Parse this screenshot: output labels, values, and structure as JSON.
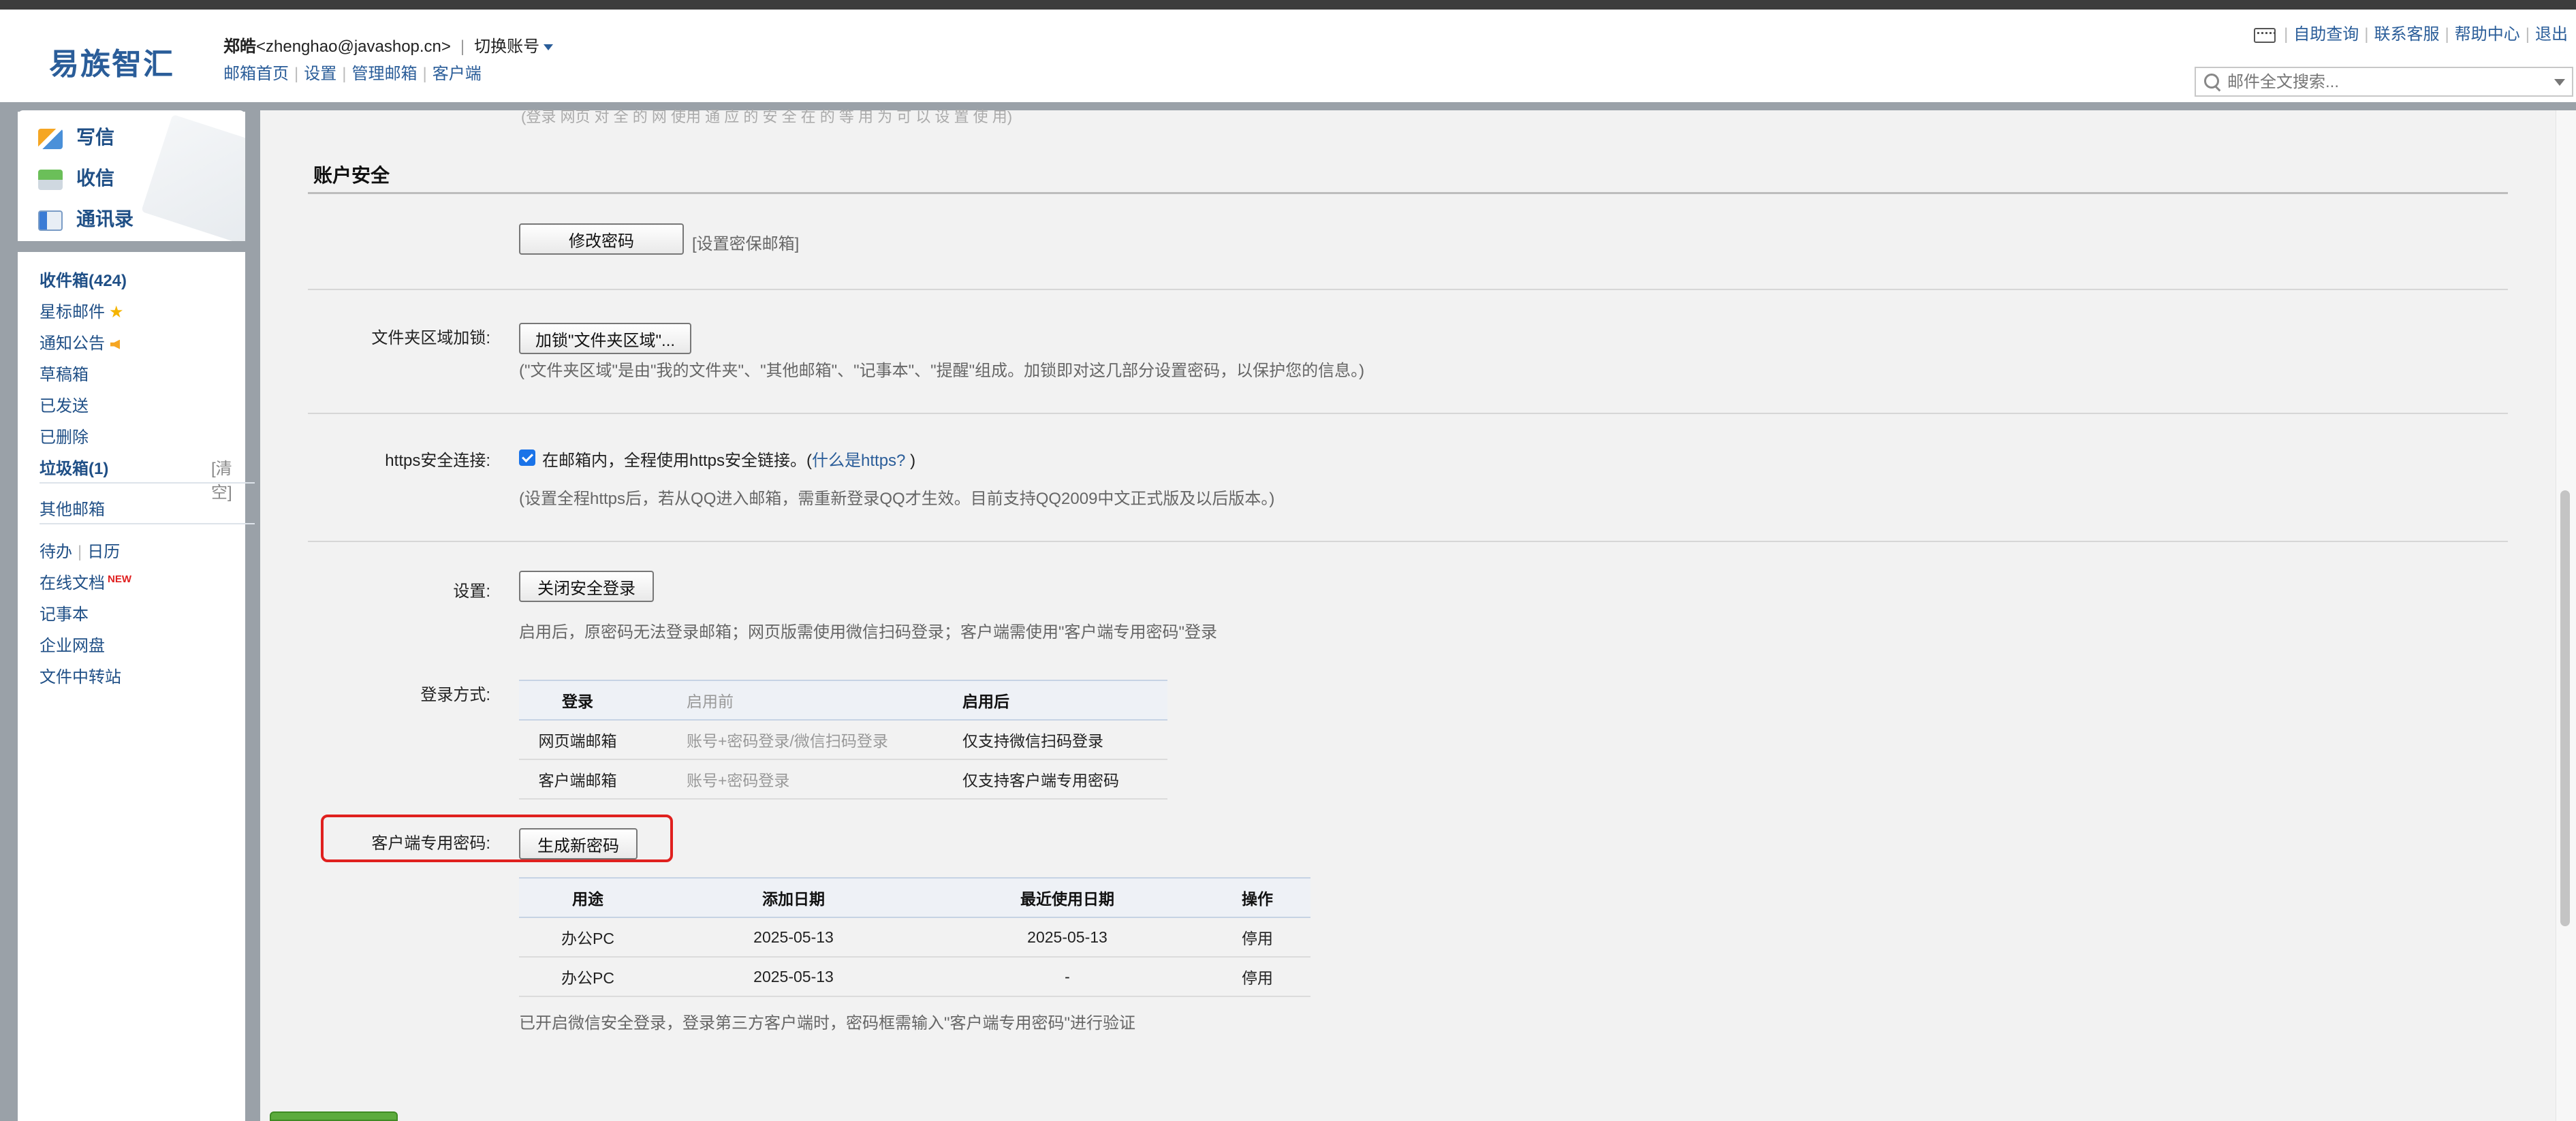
{
  "header": {
    "logo": "易族智汇",
    "user_name": "郑皓",
    "user_email": "<zhenghao@javashop.cn>",
    "switch_account": "切换账号",
    "links": [
      "邮箱首页",
      "设置",
      "管理邮箱",
      "客户端"
    ],
    "top_right_links": [
      "自助查询",
      "联系客服",
      "帮助中心",
      "退出"
    ],
    "search_placeholder": "邮件全文搜索..."
  },
  "sidebar": {
    "compose": "写信",
    "receive": "收信",
    "contacts": "通讯录",
    "folders": {
      "inbox": "收件箱(424)",
      "starred": "星标邮件",
      "notices": "通知公告",
      "drafts": "草稿箱",
      "sent": "已发送",
      "deleted": "已删除",
      "spam": "垃圾箱(1)",
      "clear": "[清空]",
      "other": "其他邮箱",
      "todo": "待办",
      "calendar": "日历",
      "docs": "在线文档",
      "new_badge": "NEW",
      "notes": "记事本",
      "disk": "企业网盘",
      "transfer": "文件中转站"
    }
  },
  "main": {
    "top_cut_text": "(登录 网页 对 全 的 网 使用 通 应 的 安 全 在 的 等 用 为 可 以 设 置 使 用)",
    "section_title": "账户安全",
    "change_password": "修改密码",
    "set_secure_email": "[设置密保邮箱]",
    "folder_lock": {
      "label": "文件夹区域加锁:",
      "button": "加锁\"文件夹区域\"...",
      "note": "(\"文件夹区域\"是由\"我的文件夹\"、\"其他邮箱\"、\"记事本\"、\"提醒\"组成。加锁即对这几部分设置密码，以保护您的信息。)"
    },
    "https": {
      "label": "https安全连接:",
      "text": "在邮箱内，全程使用https安全链接。(",
      "link": "什么是https?",
      "text_end": " )",
      "note": "(设置全程https后，若从QQ进入邮箱，需重新登录QQ才生效。目前支持QQ2009中文正式版及以后版本。)"
    },
    "settings": {
      "label": "设置:",
      "button": "关闭安全登录",
      "note": "启用后，原密码无法登录邮箱；网页版需使用微信扫码登录；客户端需使用\"客户端专用密码\"登录"
    },
    "login_mode": {
      "label": "登录方式:",
      "headers": [
        "登录",
        "启用前",
        "启用后"
      ],
      "rows": [
        [
          "网页端邮箱",
          "账号+密码登录/微信扫码登录",
          "仅支持微信扫码登录"
        ],
        [
          "客户端邮箱",
          "账号+密码登录",
          "仅支持客户端专用密码"
        ]
      ]
    },
    "client_password": {
      "label": "客户端专用密码:",
      "button": "生成新密码",
      "headers": [
        "用途",
        "添加日期",
        "最近使用日期",
        "操作"
      ],
      "rows": [
        [
          "办公PC",
          "2025-05-13",
          "2025-05-13",
          "停用"
        ],
        [
          "办公PC",
          "2025-05-13",
          "-",
          "停用"
        ]
      ],
      "note": "已开启微信安全登录，登录第三方客户端时，密码框需输入\"客户端专用密码\"进行验证"
    }
  },
  "colors": {
    "link": "#2a5d99",
    "highlight": "#e0201e",
    "frame": "#9aa1a8",
    "checkbox": "#1a73e8"
  }
}
